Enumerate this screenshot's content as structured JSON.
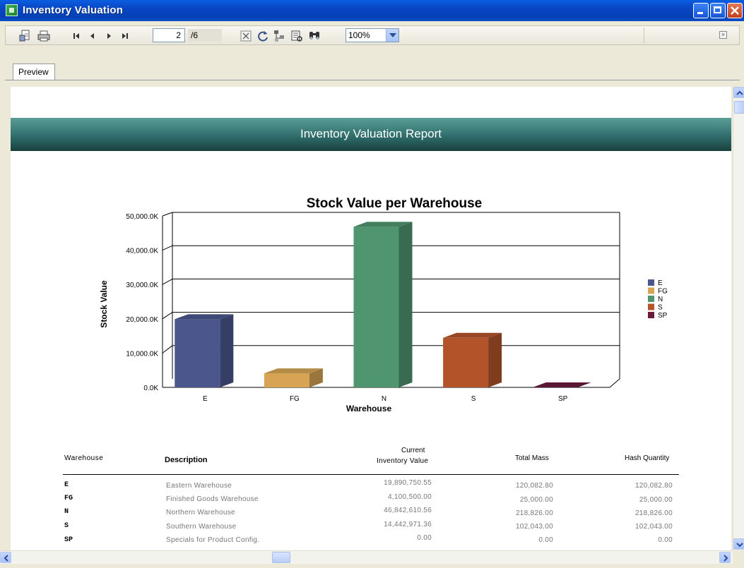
{
  "window": {
    "title": "Inventory Valuation"
  },
  "toolbar": {
    "current_page": "2",
    "total_pages": "/6",
    "zoom": "100%",
    "icons": [
      "export-icon",
      "print-icon",
      "first-page-icon",
      "previous-page-icon",
      "next-page-icon",
      "last-page-icon",
      "close-report-icon",
      "refresh-icon",
      "group-tree-icon",
      "zoom-page-icon",
      "search-text-icon",
      "close-view-icon"
    ]
  },
  "tabs": [
    {
      "label": "Preview"
    }
  ],
  "report": {
    "header": "Inventory Valuation Report"
  },
  "chart_data": {
    "type": "bar",
    "title": "Stock Value per Warehouse",
    "xlabel": "Warehouse",
    "ylabel": "Stock Value",
    "categories": [
      "E",
      "FG",
      "N",
      "S",
      "SP"
    ],
    "values": [
      19890.75,
      4100.5,
      46842.61,
      14442.97,
      0.0
    ],
    "unit": "K",
    "ylim": [
      0,
      50000
    ],
    "yticks": [
      "0.0K",
      "10,000.0K",
      "20,000.0K",
      "30,000.0K",
      "40,000.0K",
      "50,000.0K"
    ],
    "colors": [
      "#4a568c",
      "#d6a453",
      "#4e9570",
      "#b2532a",
      "#6a1b3d"
    ],
    "legend": [
      "E",
      "FG",
      "N",
      "S",
      "SP"
    ],
    "legend_position": "right",
    "grid": true
  },
  "table": {
    "headers": {
      "warehouse": "Warehouse",
      "description": "Description",
      "current_line1": "Current",
      "current_line2": "Inventory Value",
      "total_mass": "Total Mass",
      "hash_quantity": "Hash Quantity"
    },
    "rows": [
      {
        "code": "E",
        "description": "Eastern Warehouse",
        "value": "19,890,750.55",
        "mass": "120,082.80",
        "hash": "120,082.80"
      },
      {
        "code": "FG",
        "description": "Finished Goods Warehouse",
        "value": "4,100,500.00",
        "mass": "25,000.00",
        "hash": "25,000.00"
      },
      {
        "code": "N",
        "description": "Northern Warehouse",
        "value": "46,842,610.56",
        "mass": "218,826.00",
        "hash": "218,826.00"
      },
      {
        "code": "S",
        "description": "Southern Warehouse",
        "value": "14,442,971.36",
        "mass": "102,043.00",
        "hash": "102,043.00"
      },
      {
        "code": "SP",
        "description": "Specials for Product Config.",
        "value": "0.00",
        "mass": "0.00",
        "hash": "0.00"
      }
    ]
  }
}
